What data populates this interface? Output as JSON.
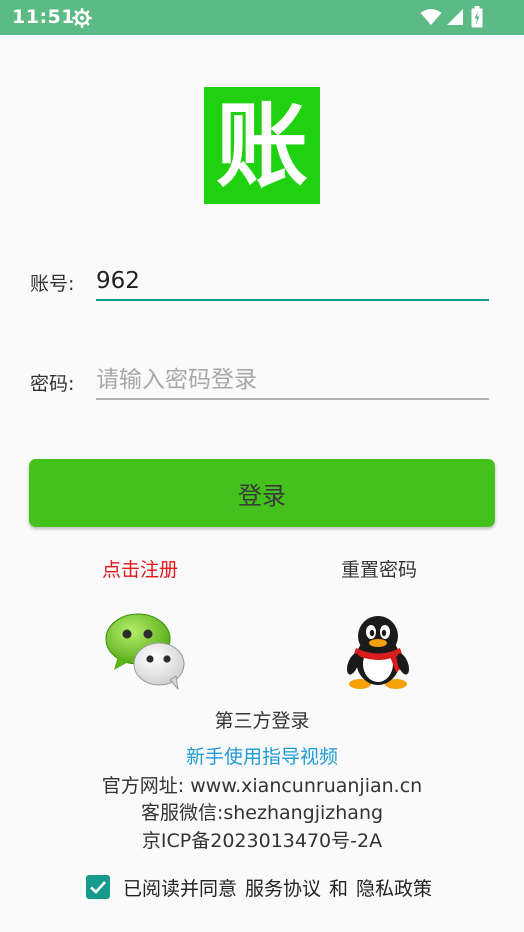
{
  "status_bar": {
    "time": "11:51"
  },
  "logo": {
    "char": "账",
    "bg_color": "#1fd10f"
  },
  "form": {
    "account_label": "账号:",
    "account_value": "962",
    "password_label": "密码:",
    "password_placeholder": "请输入密码登录"
  },
  "login_button": {
    "label": "登录",
    "color": "#45c11d"
  },
  "links": {
    "register": "点击注册",
    "reset_password": "重置密码"
  },
  "third_party": {
    "label": "第三方登录",
    "icons": [
      "wechat-icon",
      "qq-icon"
    ]
  },
  "info": {
    "guide_video": "新手使用指导视频",
    "website": "官方网址: www.xiancunruanjian.cn",
    "service_wechat": "客服微信:shezhangjizhang",
    "icp": "京ICP备2023013470号-2A"
  },
  "agreement": {
    "prefix": "已阅读并同意",
    "service": "服务协议",
    "and": "和",
    "privacy": "隐私政策",
    "checked": true
  }
}
